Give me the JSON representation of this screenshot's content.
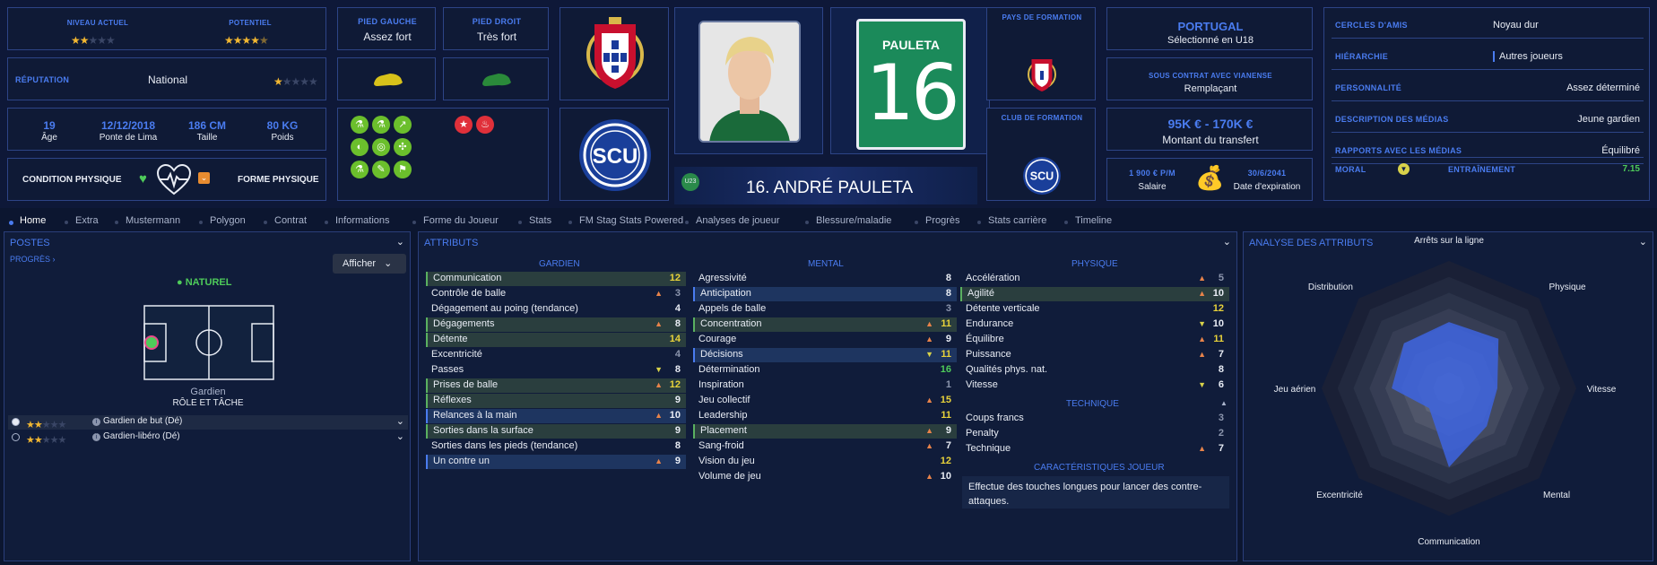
{
  "header": {
    "current_ability": {
      "label": "NIVEAU ACTUEL",
      "stars": "★★",
      "empty": "★★★"
    },
    "potential": {
      "label": "POTENTIEL",
      "stars": "★★★★",
      "half": "★",
      "empty": ""
    },
    "reputation": {
      "label": "RÉPUTATION",
      "value": "National",
      "stars": "★",
      "empty": "★★★★"
    },
    "bio": [
      {
        "value": "19",
        "label": "Âge"
      },
      {
        "value": "12/12/2018",
        "label": "Ponte de Lima"
      },
      {
        "value": "186 CM",
        "label": "Taille"
      },
      {
        "value": "80 KG",
        "label": "Poids"
      }
    ],
    "condition": {
      "label": "CONDITION PHYSIQUE",
      "form_label": "FORME PHYSIQUE"
    },
    "left_foot": {
      "label": "PIED GAUCHE",
      "value": "Assez fort"
    },
    "right_foot": {
      "label": "PIED DROIT",
      "value": "Très fort"
    },
    "player": {
      "name": "16. ANDRÉ PAULETA",
      "shirt_name": "PAULETA",
      "shirt_number": "16",
      "badge": "U23"
    },
    "training_country": {
      "label": "PAYS DE FORMATION"
    },
    "training_club": {
      "label": "CLUB DE FORMATION",
      "crest_text": "SCU"
    },
    "nation": {
      "name": "PORTUGAL",
      "sub": "Sélectionné en U18"
    },
    "contract": {
      "label": "SOUS CONTRAT AVEC VIANENSE",
      "value": "Remplaçant"
    },
    "transfer": {
      "value": "95K € - 170K €",
      "label": "Montant du transfert"
    },
    "salary": {
      "value": "1 900 € P/M",
      "label": "Salaire"
    },
    "expiry": {
      "value": "30/6/2041",
      "label": "Date d'expiration"
    },
    "club_crest_text": "SCU",
    "info": [
      {
        "label": "CERCLES D'AMIS",
        "value": "Noyau dur"
      },
      {
        "label": "HIÉRARCHIE",
        "value": "Autres joueurs"
      },
      {
        "label": "PERSONNALITÉ",
        "value": "Assez déterminé"
      },
      {
        "label": "DESCRIPTION DES MÉDIAS",
        "value": "Jeune gardien"
      },
      {
        "label": "RAPPORTS AVEC LES MÉDIAS",
        "value": "Équilibré"
      }
    ],
    "morale": {
      "label": "MORAL",
      "training_label": "ENTRAÎNEMENT",
      "training_value": "7.15"
    }
  },
  "tabs": [
    "Home",
    "Extra",
    "Mustermann",
    "Polygon",
    "Contrat",
    "Informations",
    "Forme du Joueur",
    "Stats",
    "FM Stag Stats Powered",
    "Analyses de joueur",
    "Blessure/maladie",
    "Progrès",
    "Stats carrière",
    "Timeline"
  ],
  "positions": {
    "title": "POSTES",
    "progress_link": "PROGRÈS",
    "show_button": "Afficher",
    "natural_label": "NATUREL",
    "position_name": "Gardien",
    "role_title": "RÔLE ET TÂCHE",
    "roles": [
      {
        "stars": "★★",
        "empty": "★★★",
        "name": "Gardien de but (Dé)"
      },
      {
        "stars": "★★",
        "empty": "★★★",
        "name": "Gardien-libéro (Dé)"
      }
    ]
  },
  "attributes": {
    "title": "ATTRIBUTS",
    "gk_head": "GARDIEN",
    "mental_head": "MENTAL",
    "physical_head": "PHYSIQUE",
    "technical_head": "TECHNIQUE",
    "traits_head": "CARACTÉRISTIQUES JOUEUR",
    "traits_text": "Effectue des touches longues pour lancer des contre-attaques.",
    "gk": [
      {
        "n": "Communication",
        "v": "12",
        "c": "y",
        "hl": "g"
      },
      {
        "n": "Contrôle de balle",
        "v": "3",
        "c": "gr",
        "ar": "r"
      },
      {
        "n": "Dégagement au poing (tendance)",
        "v": "4",
        "c": "w"
      },
      {
        "n": "Dégagements",
        "v": "8",
        "c": "w",
        "ar": "r",
        "hl": "g"
      },
      {
        "n": "Détente",
        "v": "14",
        "c": "y",
        "hl": "g"
      },
      {
        "n": "Excentricité",
        "v": "4",
        "c": "gr"
      },
      {
        "n": "Passes",
        "v": "8",
        "c": "w",
        "ar": "y"
      },
      {
        "n": "Prises de balle",
        "v": "12",
        "c": "y",
        "ar": "r",
        "hl": "g"
      },
      {
        "n": "Réflexes",
        "v": "9",
        "c": "w",
        "hl": "g"
      },
      {
        "n": "Relances à la main",
        "v": "10",
        "c": "w",
        "ar": "r",
        "hl": "b"
      },
      {
        "n": "Sorties dans la surface",
        "v": "9",
        "c": "w",
        "hl": "g"
      },
      {
        "n": "Sorties dans les pieds (tendance)",
        "v": "8",
        "c": "w"
      },
      {
        "n": "Un contre un",
        "v": "9",
        "c": "w",
        "ar": "r",
        "hl": "b"
      }
    ],
    "mental": [
      {
        "n": "Agressivité",
        "v": "8",
        "c": "w"
      },
      {
        "n": "Anticipation",
        "v": "8",
        "c": "w",
        "hl": "b"
      },
      {
        "n": "Appels de balle",
        "v": "3",
        "c": "gr"
      },
      {
        "n": "Concentration",
        "v": "11",
        "c": "y",
        "ar": "r",
        "hl": "g"
      },
      {
        "n": "Courage",
        "v": "9",
        "c": "w",
        "ar": "r"
      },
      {
        "n": "Décisions",
        "v": "11",
        "c": "y",
        "ar": "y",
        "hl": "b"
      },
      {
        "n": "Détermination",
        "v": "16",
        "c": "g"
      },
      {
        "n": "Inspiration",
        "v": "1",
        "c": "gr"
      },
      {
        "n": "Jeu collectif",
        "v": "15",
        "c": "y",
        "ar": "r"
      },
      {
        "n": "Leadership",
        "v": "11",
        "c": "y"
      },
      {
        "n": "Placement",
        "v": "9",
        "c": "w",
        "ar": "r",
        "hl": "g"
      },
      {
        "n": "Sang-froid",
        "v": "7",
        "c": "w",
        "ar": "r"
      },
      {
        "n": "Vision du jeu",
        "v": "12",
        "c": "y"
      },
      {
        "n": "Volume de jeu",
        "v": "10",
        "c": "w",
        "ar": "r"
      }
    ],
    "physical": [
      {
        "n": "Accélération",
        "v": "5",
        "c": "gr",
        "ar": "r"
      },
      {
        "n": "Agilité",
        "v": "10",
        "c": "w",
        "ar": "r",
        "hl": "g"
      },
      {
        "n": "Détente verticale",
        "v": "12",
        "c": "y"
      },
      {
        "n": "Endurance",
        "v": "10",
        "c": "w",
        "ar": "y"
      },
      {
        "n": "Équilibre",
        "v": "11",
        "c": "y",
        "ar": "r"
      },
      {
        "n": "Puissance",
        "v": "7",
        "c": "w",
        "ar": "r"
      },
      {
        "n": "Qualités phys. nat.",
        "v": "8",
        "c": "w"
      },
      {
        "n": "Vitesse",
        "v": "6",
        "c": "w",
        "ar": "y"
      }
    ],
    "technical": [
      {
        "n": "Coups francs",
        "v": "3",
        "c": "gr"
      },
      {
        "n": "Penalty",
        "v": "2",
        "c": "gr"
      },
      {
        "n": "Technique",
        "v": "7",
        "c": "w",
        "ar": "r"
      }
    ]
  },
  "analysis": {
    "title": "ANALYSE DES ATTRIBUTS",
    "axes": [
      "Arrêts sur la ligne",
      "Physique",
      "Vitesse",
      "Mental",
      "Communication",
      "Excentricité",
      "Jeu aérien",
      "Distribution"
    ],
    "values": [
      0.52,
      0.55,
      0.38,
      0.42,
      0.62,
      0.22,
      0.45,
      0.5
    ]
  },
  "colors": {
    "accent": "#4a7cf0",
    "panel": "#101c3a",
    "border": "#2a3e7a",
    "green": "#4ecb5a",
    "yellow": "#e8d23a",
    "pitch": "#12223e"
  }
}
